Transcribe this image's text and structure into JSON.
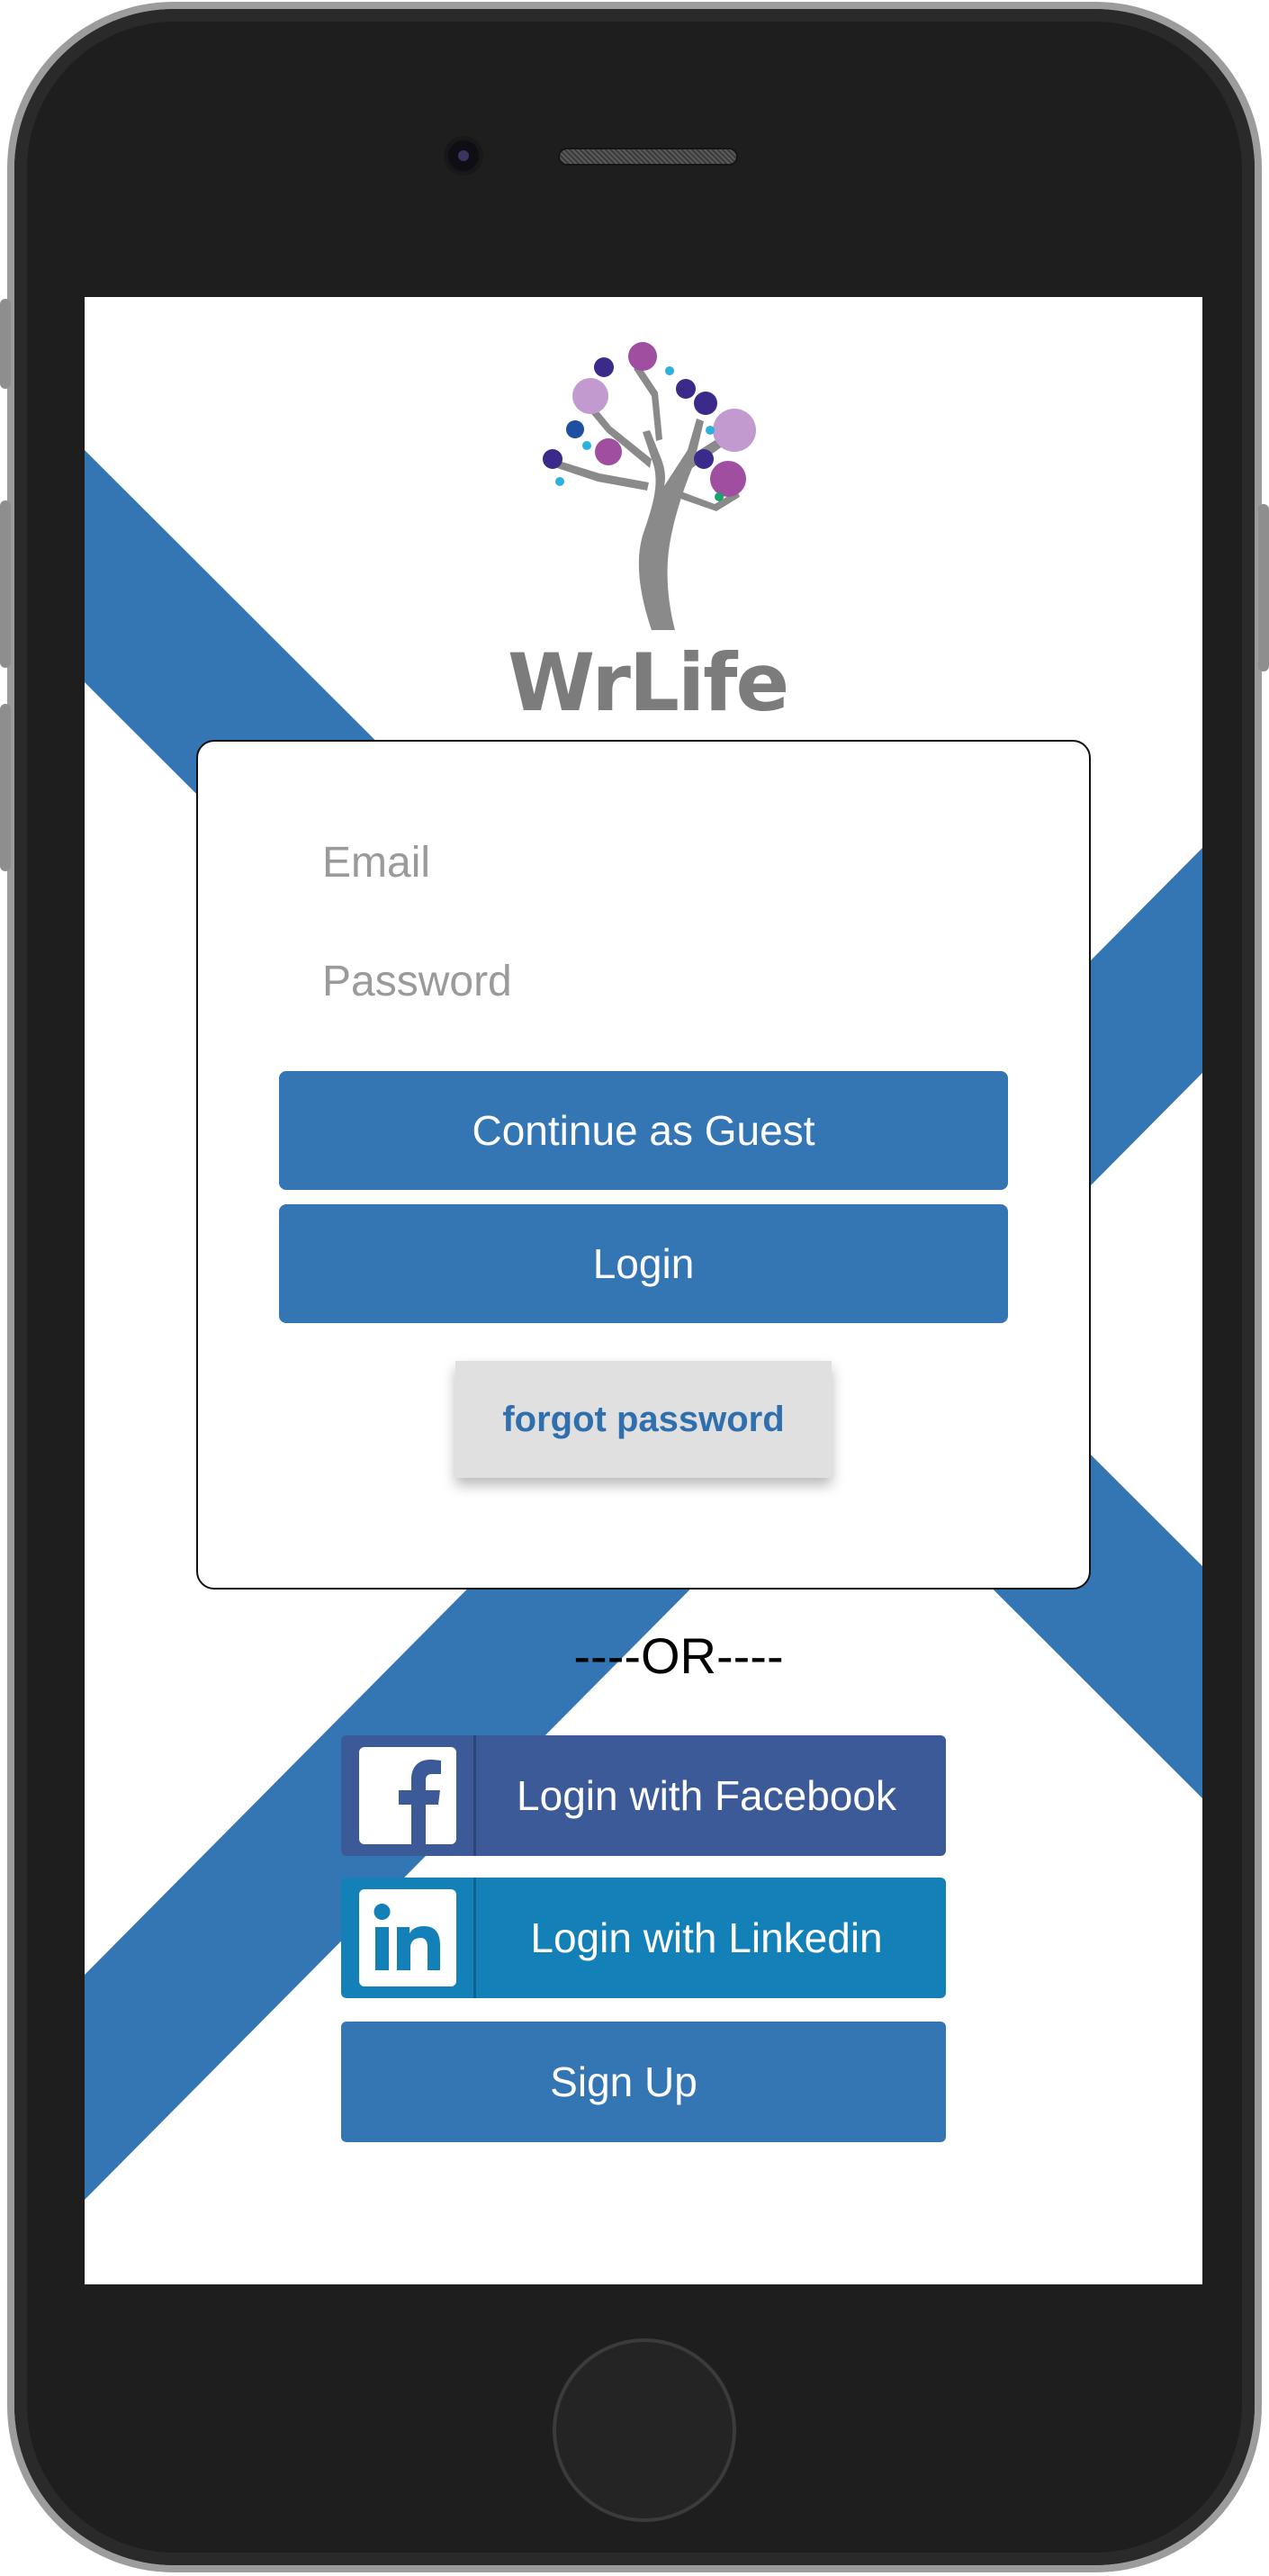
{
  "app": {
    "logo_text": "WrLife"
  },
  "login_form": {
    "email_placeholder": "Email",
    "password_placeholder": "Password",
    "guest_label": "Continue as Guest",
    "login_label": "Login",
    "forgot_label": "forgot password"
  },
  "divider_text": "----OR----",
  "social": {
    "facebook_label": "Login with Facebook",
    "linkedin_label": "Login with Linkedin"
  },
  "signup_label": "Sign Up",
  "colors": {
    "primary_blue": "#3475b4",
    "facebook_blue": "#3c5a98",
    "linkedin_blue": "#1380b8",
    "forgot_text": "#2f6fae",
    "forgot_bg": "#e0e0e0",
    "logo_gray": "#7c7c7c",
    "logo_purple": "#a04fa0",
    "logo_lavender": "#c39ad0",
    "logo_navy": "#3b2a8a",
    "logo_cyan": "#2bb0e0"
  },
  "icons": {
    "facebook": "facebook-icon",
    "linkedin": "linkedin-icon",
    "logo": "tree-logo-icon"
  }
}
